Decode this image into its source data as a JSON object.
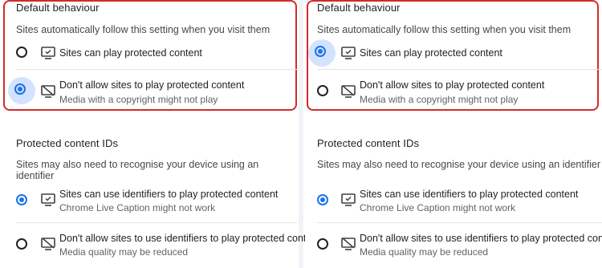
{
  "default_behaviour": {
    "heading": "Default behaviour",
    "description": "Sites automatically follow this setting when you visit them",
    "allow": {
      "label": "Sites can play protected content",
      "icon": "monitor-check-icon"
    },
    "block": {
      "label": "Don't allow sites to play protected content",
      "sublabel": "Media with a copyright might not play",
      "icon": "monitor-blocked-icon"
    }
  },
  "protected_ids": {
    "heading": "Protected content IDs",
    "description": "Sites may also need to recognise your device using an identifier",
    "allow": {
      "label": "Sites can use identifiers to play protected content",
      "sublabel": "Chrome Live Caption might not work",
      "icon": "monitor-check-icon"
    },
    "block": {
      "label": "Don't allow sites to use identifiers to play protected content",
      "sublabel": "Media quality may be reduced",
      "icon": "monitor-blocked-icon"
    }
  },
  "panels": [
    {
      "default_selected": "block",
      "ids_selected": "allow"
    },
    {
      "default_selected": "allow",
      "ids_selected": "allow"
    }
  ],
  "colors": {
    "accent": "#1a73e8",
    "highlight_box": "#d32a2a",
    "selected_halo": "#d3e3fd"
  }
}
